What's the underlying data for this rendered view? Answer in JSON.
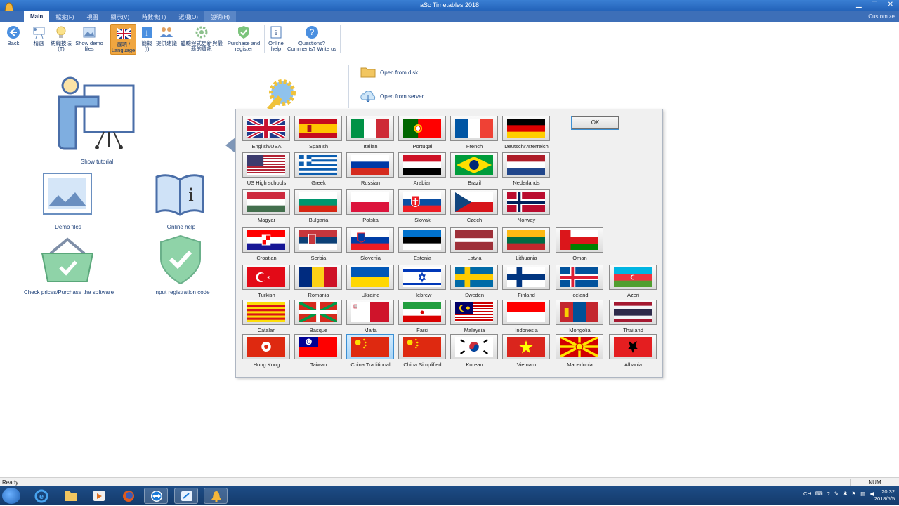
{
  "window": {
    "title": "aSc Timetables 2018"
  },
  "menu": {
    "tabs": [
      "Main",
      "檔案(F)",
      "視圖",
      "顯示(V)",
      "時數表(T)",
      "選項(O)",
      "說明(H)"
    ],
    "customize": "Customize"
  },
  "ribbon": {
    "back": "Back",
    "b2": "精選",
    "b3": "紡織技法(T)",
    "demo_files": "Show demo files",
    "language": "選項 / Language",
    "b6": "簡報(I)",
    "b7": "提供建議",
    "b8": "體驗程式更新與最新的資訊",
    "purchase": "Purchase and register",
    "online_help": "Online help",
    "questions": "Questions? Comments? Write us"
  },
  "main": {
    "show_tutorial": "Show tutorial",
    "demo_files": "Demo files",
    "online_help": "Online help",
    "check_prices": "Check prices/Purchase the software",
    "input_code": "Input registration code",
    "open_from_disk": "Open from disk",
    "open_from_server": "Open from server"
  },
  "dialog": {
    "ok": "OK",
    "selected_language": "China Traditional",
    "rows": [
      [
        "English/USA",
        "Spanish",
        "Italian",
        "Portugal",
        "French",
        "Deutsch/?sterreich"
      ],
      [
        "US High schools",
        "Greek",
        "Russian",
        "Arabian",
        "Brazil",
        "Nederlands"
      ],
      [
        "Magyar",
        "Bulgaria",
        "Polska",
        "Slovak",
        "Czech",
        "Norway"
      ],
      [
        "Croatian",
        "Serbia",
        "Slovenia",
        "Estonia",
        "Latvia",
        "Lithuania",
        "Oman"
      ],
      [
        "Turkish",
        "Romania",
        "Ukraine",
        "Hebrew",
        "Sweden",
        "Finland",
        "Iceland",
        "Azeri"
      ],
      [
        "Catalan",
        "Basque",
        "Malta",
        "Farsi",
        "Malaysia",
        "Indonesia",
        "Mongolia",
        "Thailand"
      ],
      [
        "Hong Kong",
        "Taiwan",
        "China Traditional",
        "China Simplified",
        "Korean",
        "Vietnam",
        "Macedonia",
        "Albania"
      ]
    ]
  },
  "status": {
    "ready": "Ready",
    "num": "NUM"
  },
  "taskbar": {
    "lang": "CH",
    "time": "20:32",
    "date": "2018/5/5"
  }
}
